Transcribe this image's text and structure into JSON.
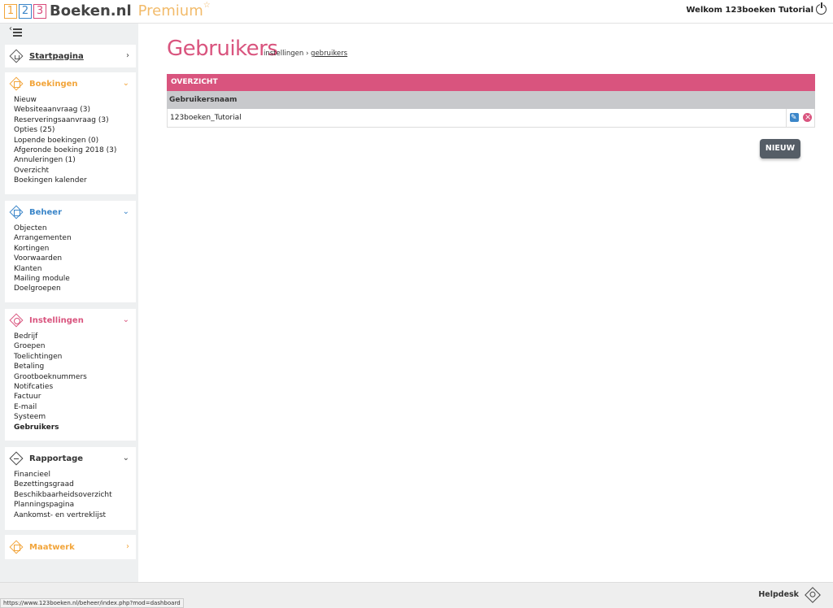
{
  "header": {
    "logo_digits": [
      "1",
      "2",
      "3"
    ],
    "brand": "Boeken.nl",
    "premium": "Premium",
    "star": "☆",
    "welcome": "Welkom 123boeken Tutorial"
  },
  "sidebar": {
    "start": {
      "title": "Startpagina"
    },
    "bookings": {
      "title": "Boekingen",
      "color": "#f2a53b",
      "items": [
        "Nieuw",
        "Websiteaanvraag (3)",
        "Reserveringsaanvraag (3)",
        "Opties (25)",
        "Lopende boekingen (0)",
        "Afgeronde boeking 2018 (3)",
        "Annuleringen (1)",
        "Overzicht",
        "Boekingen kalender"
      ]
    },
    "beheer": {
      "title": "Beheer",
      "color": "#3b86c9",
      "items": [
        "Objecten",
        "Arrangementen",
        "Kortingen",
        "Voorwaarden",
        "Klanten",
        "Mailing module",
        "Doelgroepen"
      ]
    },
    "instellingen": {
      "title": "Instellingen",
      "color": "#d9547e",
      "items": [
        "Bedrijf",
        "Groepen",
        "Toelichtingen",
        "Betaling",
        "Grootboeknummers",
        "Notifcaties",
        "Factuur",
        "E-mail",
        "Systeem",
        "Gebruikers"
      ]
    },
    "rapportage": {
      "title": "Rapportage",
      "color": "#333333",
      "items": [
        "Financieel",
        "Bezettingsgraad",
        "Beschikbaarheidsoverzicht",
        "Planningspagina",
        "Aankomst- en vertreklijst"
      ]
    },
    "maatwerk": {
      "title": "Maatwerk",
      "color": "#f2a53b"
    }
  },
  "main": {
    "title": "Gebruikers",
    "breadcrumb": {
      "parent": "instellingen",
      "sep": "›",
      "current": "gebruikers"
    },
    "panel_title": "OVERZICHT",
    "column": "Gebruikersnaam",
    "rows": [
      "123boeken_Tutorial"
    ],
    "new_button": "NIEUW"
  },
  "footer": {
    "status_url": "https://www.123boeken.nl/beheer/index.php?mod=dashboard",
    "helpdesk": "Helpdesk"
  }
}
